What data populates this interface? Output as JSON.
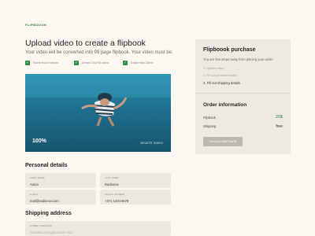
{
  "brand": "FLIPBOOOK",
  "upload": {
    "title": "Upload video to create a flipbook",
    "subtitle": "Your video will be converted into 99 page flipbook. Your video must be:",
    "requirements": [
      "Shorter than 5 minutes",
      "At least 720p HD videos",
      "Smaller than 150mb"
    ]
  },
  "video": {
    "progress_label": "100%",
    "delete_label": "DELETE VIDEO",
    "progress": 1.0
  },
  "personal": {
    "heading": "Personal details",
    "first_name": {
      "label": "FIRST NAME",
      "value": "Anton"
    },
    "last_name": {
      "label": "LAST NAME",
      "value": "Radionov"
    },
    "email": {
      "label": "E-MAIL",
      "value": "mail@radionov.com"
    },
    "phone": {
      "label": "PHONE NUMBER",
      "value": "+371 1234 5678"
    }
  },
  "shipping": {
    "heading": "Shipping address",
    "street": {
      "label": "STREET ADDRESS",
      "placeholder": "Gustava Zemgala Gatve 80/2"
    }
  },
  "purchase": {
    "heading": "Flipboook purchase",
    "subtitle": "You are few steps away from placing your order",
    "steps": [
      "1. Upload video",
      "2. Fill out personal details",
      "3. Fill out shipping details"
    ],
    "order_heading": "Order information",
    "rows": [
      {
        "label": "Flipbook",
        "value": "20$"
      },
      {
        "label": "Shipping",
        "value": "free"
      }
    ],
    "pay_button": "Checkout with PayPal"
  },
  "colors": {
    "accent": "#2e8b46",
    "background": "#fbf7f1",
    "panel": "#eeeae3"
  }
}
